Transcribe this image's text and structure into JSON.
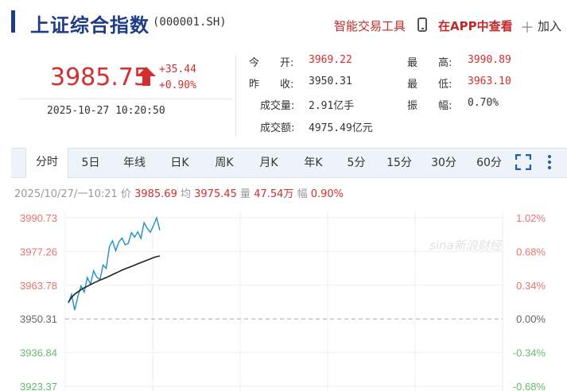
{
  "header": {
    "title": "上证综合指数",
    "code": "(000001.SH)",
    "tool_link": "智能交易工具",
    "app_link": "在APP中查看",
    "add_label": "加入"
  },
  "quote": {
    "price": "3985.75",
    "change": "+35.44",
    "change_pct": "+0.90%",
    "datetime": "2025-10-27 10:20:50"
  },
  "stats": {
    "open": {
      "label": "今　　开:",
      "value": "3969.22"
    },
    "prev_close": {
      "label": "昨　　收:",
      "value": "3950.31"
    },
    "volume": {
      "label": "成交量:",
      "value": "2.91亿手"
    },
    "turnover": {
      "label": "成交额:",
      "value": "4975.49亿元"
    },
    "high": {
      "label": "最　　高:",
      "value": "3990.89"
    },
    "low": {
      "label": "最　　低:",
      "value": "3963.10"
    },
    "amplitude": {
      "label": "振　　幅:",
      "value": "0.70%"
    }
  },
  "tabs": [
    "分时",
    "5日",
    "年线",
    "日K",
    "周K",
    "月K",
    "年K",
    "5分",
    "15分",
    "30分",
    "60分"
  ],
  "active_tab": "分时",
  "infoline": {
    "datetime": "2025/10/27/一10:21",
    "price_label": "价",
    "price": "3985.69",
    "avg_label": "均",
    "avg": "3975.45",
    "vol_label": "量",
    "vol": "47.54万",
    "amp_label": "幅",
    "amp": "0.90%"
  },
  "chart_data": {
    "type": "line",
    "prev_close": 3950.31,
    "left_ticks": [
      "3990.73",
      "3977.26",
      "3963.78",
      "3950.31",
      "3936.84",
      "3923.37"
    ],
    "right_ticks": [
      "1.02%",
      "0.68%",
      "0.34%",
      "0.00%",
      "-0.34%",
      "-0.68%"
    ],
    "ylim": [
      3923.37,
      3990.73
    ],
    "watermark": "sina新浪财经",
    "series": [
      {
        "values": [
          3956.5,
          3960.1,
          3953.8,
          3959.2,
          3963.5,
          3961.0,
          3966.8,
          3964.2,
          3969.5,
          3967.0,
          3966.0,
          3971.8,
          3970.5,
          3979.2,
          3981.5,
          3977.5,
          3981.0,
          3982.6,
          3979.9,
          3980.5,
          3984.8,
          3983.0,
          3985.1,
          3982.5,
          3988.8,
          3986.5,
          3984.9,
          3987.7,
          3990.7,
          3985.7
        ],
        "color": "#1f8fc4"
      },
      {
        "values": [
          3957.0,
          3958.9,
          3960.2,
          3961.1,
          3962.0,
          3962.7,
          3963.3,
          3964.0,
          3964.6,
          3965.2,
          3965.8,
          3966.3,
          3966.8,
          3967.4,
          3968.0,
          3968.6,
          3969.2,
          3969.8,
          3970.3,
          3970.8,
          3971.3,
          3971.8,
          3972.3,
          3972.8,
          3973.3,
          3973.8,
          3974.3,
          3974.8,
          3975.2,
          3975.45
        ],
        "color": "#222222"
      }
    ]
  }
}
